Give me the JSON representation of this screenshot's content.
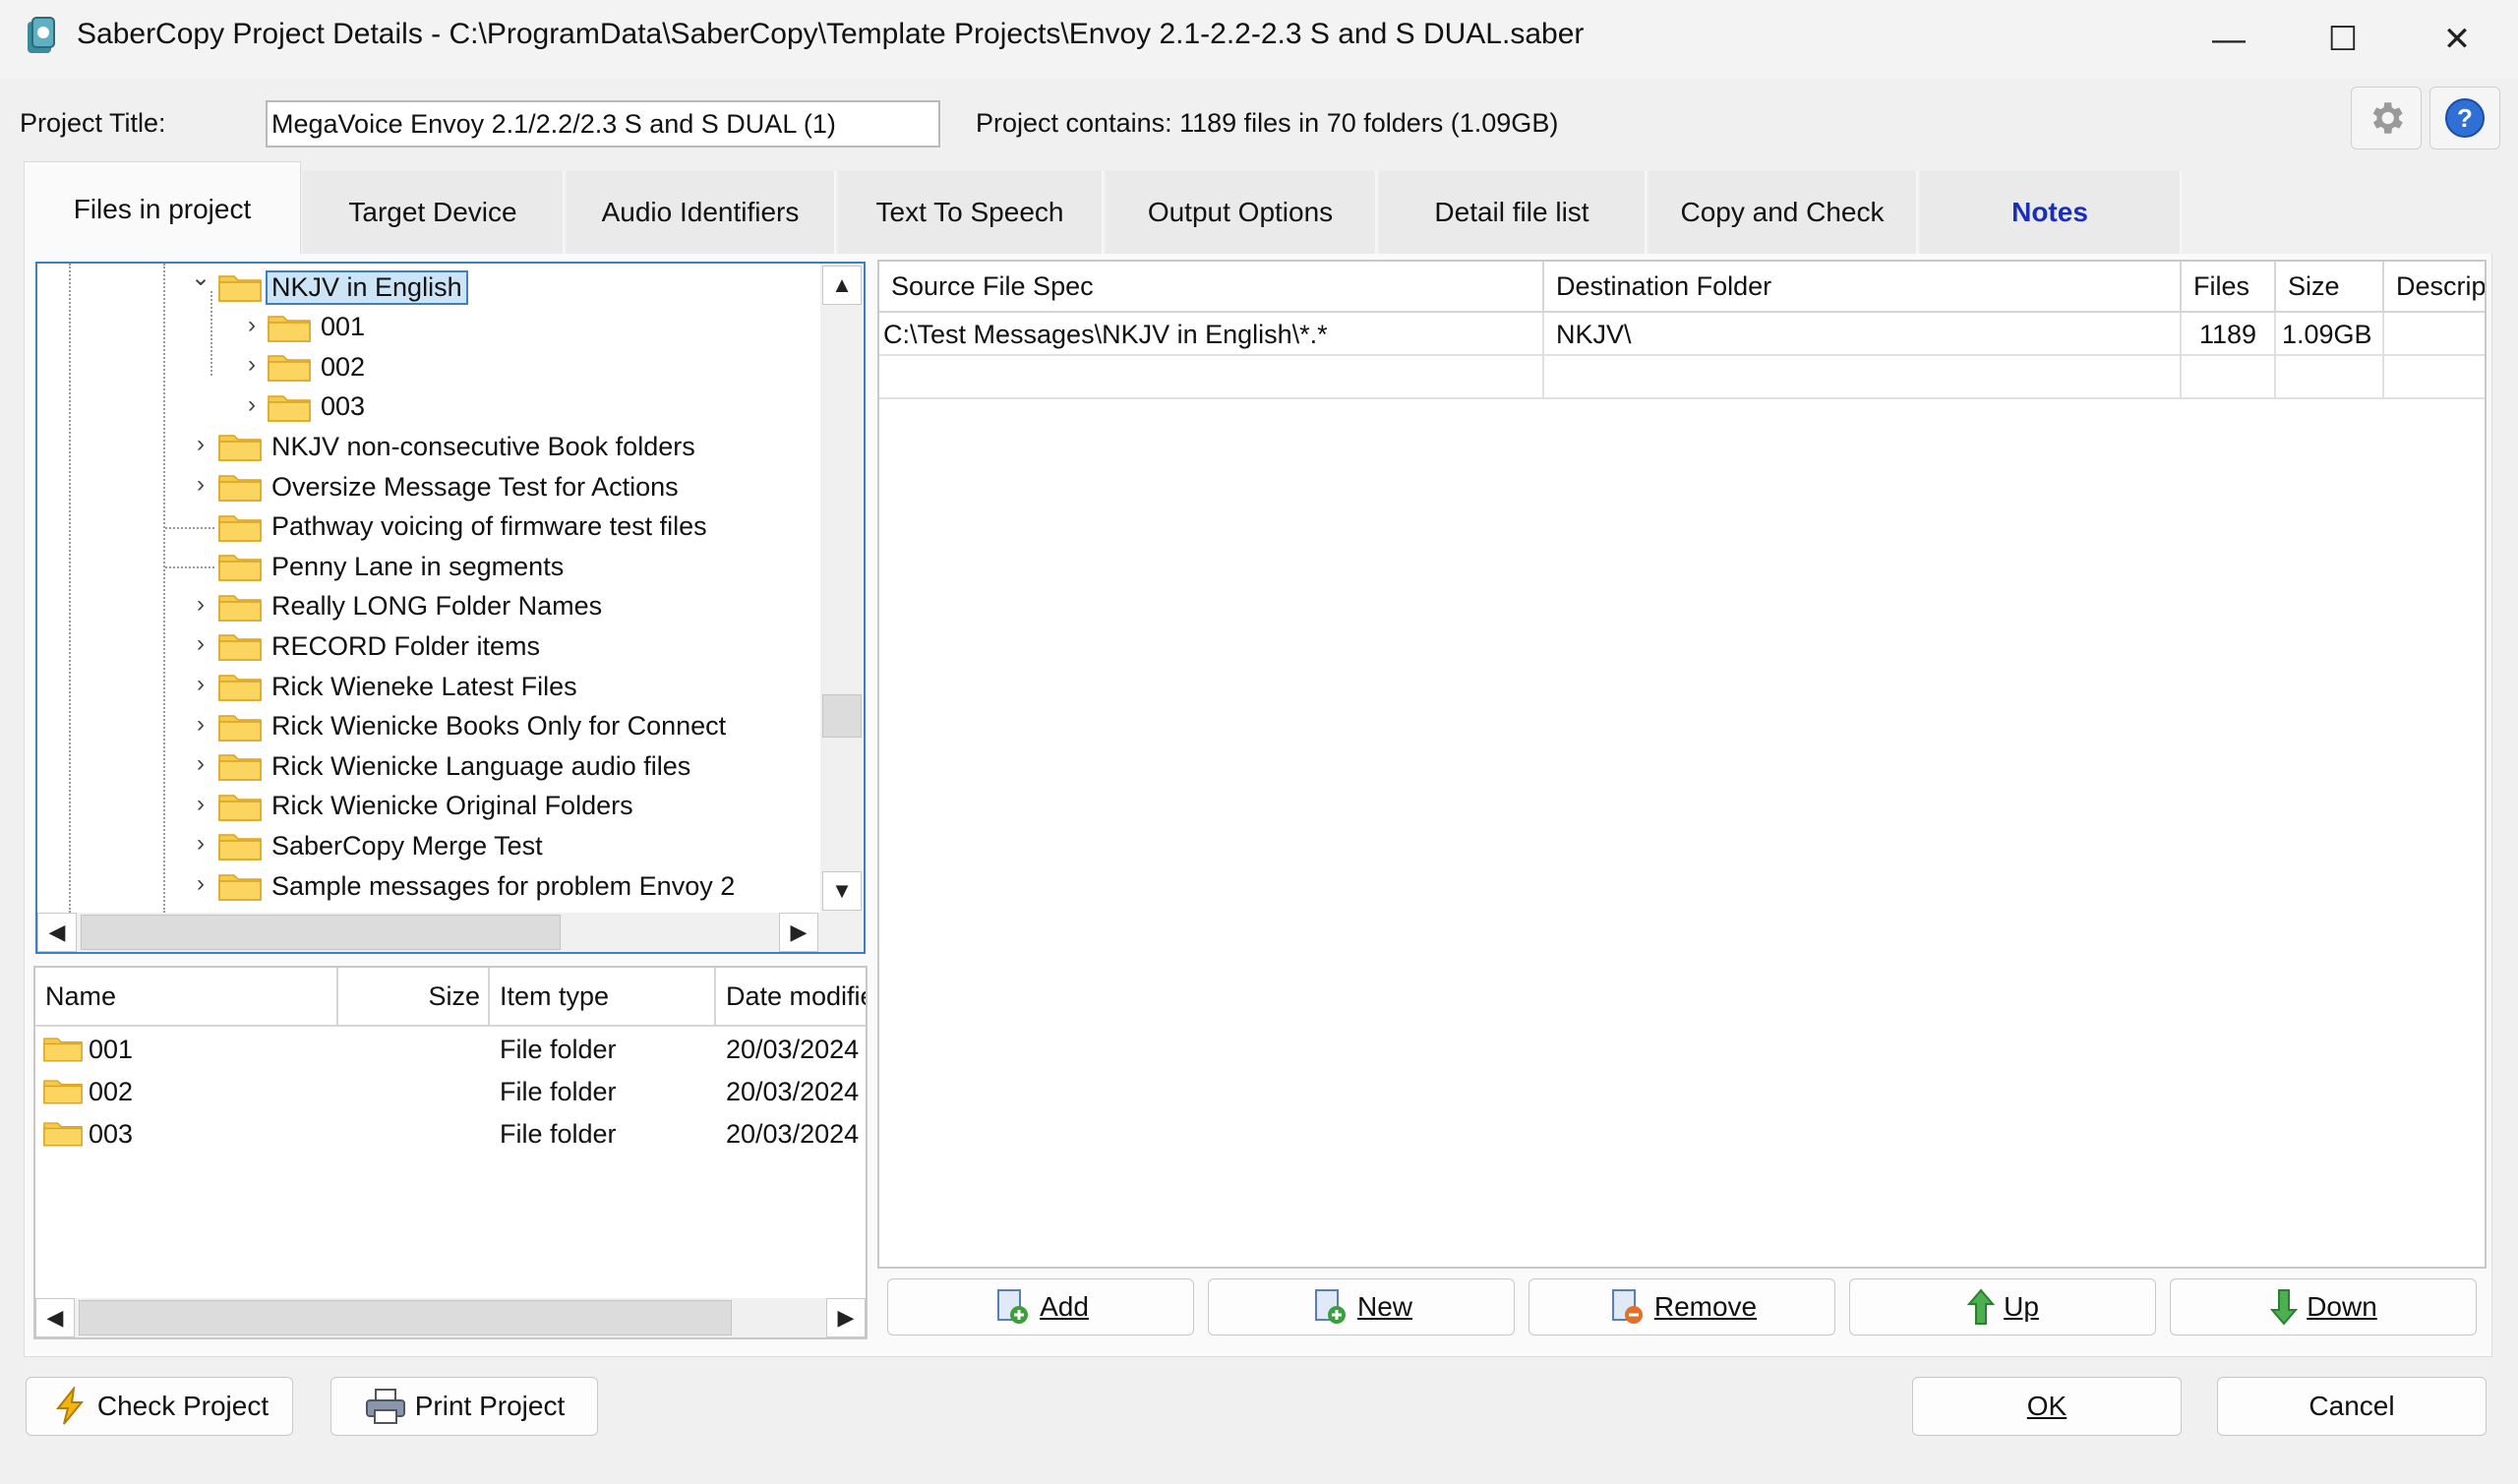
{
  "window": {
    "title": "SaberCopy Project Details - C:\\ProgramData\\SaberCopy\\Template Projects\\Envoy 2.1-2.2-2.3 S and S DUAL.saber",
    "minimize_glyph": "—",
    "maximize_glyph": "☐",
    "close_glyph": "✕"
  },
  "project": {
    "title_label": "Project Title:",
    "title_value": "MegaVoice Envoy 2.1/2.2/2.3 S and S DUAL (1)",
    "contains_text": "Project contains: 1189 files in 70 folders (1.09GB)"
  },
  "tabs": [
    {
      "label": "Files in project",
      "active": true
    },
    {
      "label": "Target Device"
    },
    {
      "label": "Audio Identifiers"
    },
    {
      "label": "Text To Speech"
    },
    {
      "label": "Output Options"
    },
    {
      "label": "Detail file list"
    },
    {
      "label": "Copy and Check"
    },
    {
      "label": "Notes",
      "color": "#1a2fb5"
    }
  ],
  "tree": {
    "items": [
      {
        "label": "NKJV in English",
        "expanded": true,
        "selected": true
      },
      {
        "label": "001"
      },
      {
        "label": "002"
      },
      {
        "label": "003"
      },
      {
        "label": "NKJV non-consecutive Book folders"
      },
      {
        "label": "Oversize Message Test for Actions"
      },
      {
        "label": "Pathway voicing of firmware test files"
      },
      {
        "label": "Penny Lane in segments"
      },
      {
        "label": "Really LONG Folder Names"
      },
      {
        "label": "RECORD Folder items"
      },
      {
        "label": "Rick Wieneke Latest Files"
      },
      {
        "label": "Rick Wienicke Books Only for Connect"
      },
      {
        "label": "Rick Wienicke Language audio files"
      },
      {
        "label": "Rick Wienicke Original Folders"
      },
      {
        "label": "SaberCopy Merge Test"
      },
      {
        "label": "Sample messages for problem Envoy 2"
      }
    ]
  },
  "list": {
    "columns": [
      "Name",
      "Size",
      "Item type",
      "Date modifie"
    ],
    "rows": [
      {
        "name": "001",
        "size": "",
        "type": "File folder",
        "date": "20/03/2024"
      },
      {
        "name": "002",
        "size": "",
        "type": "File folder",
        "date": "20/03/2024"
      },
      {
        "name": "003",
        "size": "",
        "type": "File folder",
        "date": "20/03/2024"
      }
    ]
  },
  "grid": {
    "columns": [
      "Source File Spec",
      "Destination Folder",
      "Files",
      "Size",
      "Descrip"
    ],
    "rows": [
      {
        "source": "C:\\Test Messages\\NKJV in English\\*.*",
        "dest": "NKJV\\",
        "files": "1189",
        "size": "1.09GB",
        "desc": ""
      }
    ]
  },
  "buttons": {
    "add": "Add",
    "new": "New",
    "remove": "Remove",
    "up": "Up",
    "down": "Down",
    "check_project": "Check Project",
    "print_project": "Print Project",
    "ok": "OK",
    "cancel": "Cancel"
  },
  "colors": {
    "selection_border": "#3c7fc3",
    "folder_yellow": "#f7c948",
    "notes_tab": "#1a2fb5",
    "help_blue": "#2f6fd6"
  },
  "icons": [
    "app-icon",
    "gear-icon",
    "help-icon",
    "folder-icon",
    "add-file-icon",
    "new-file-icon",
    "remove-file-icon",
    "up-arrow-icon",
    "down-arrow-icon",
    "lightning-icon",
    "printer-icon"
  ]
}
